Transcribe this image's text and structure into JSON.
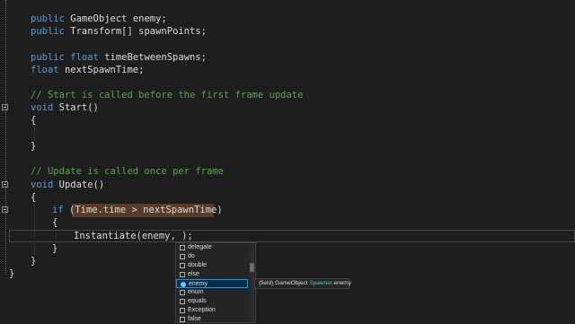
{
  "code": {
    "l1": {
      "kw": "public",
      "ty": "GameObject",
      "rest": "enemy;"
    },
    "l2": {
      "kw": "public",
      "ty": "Transform[]",
      "rest": "spawnPoints;"
    },
    "l3": {
      "kw": "public",
      "ty": "float",
      "rest": "timeBetweenSpawns;"
    },
    "l4": {
      "ty": "float",
      "rest": "nextSpawnTime;"
    },
    "l5": {
      "cm": "// Start is called before the first frame update"
    },
    "l6": {
      "kw": "void",
      "rest": "Start()"
    },
    "l7": {
      "text": "{"
    },
    "l8": {
      "text": "}"
    },
    "l9": {
      "cm": "// Update is called once per frame"
    },
    "l10": {
      "kw": "void",
      "rest": "Update()"
    },
    "l11": {
      "text": "{"
    },
    "l12": {
      "kw": "if",
      "open": "(",
      "hl": "Time.time > nextSpawnTime",
      "close": ")"
    },
    "l13": {
      "text": "{"
    },
    "l14": {
      "text": "Instantiate(enemy, );"
    },
    "l15": {
      "text": "}"
    },
    "l16": {
      "text": "}"
    },
    "l17": {
      "text": "}"
    }
  },
  "completion": {
    "items": [
      "delegate",
      "do",
      "double",
      "else",
      "enemy",
      "enum",
      "equals",
      "Exception",
      "false"
    ],
    "selected_index": 4
  },
  "tooltip": {
    "prefix": "(field) GameObject ",
    "type": "Spawner",
    "suffix": ".enemy"
  },
  "colors": {
    "keyword": "#569cd6",
    "type": "#4ec9b0",
    "comment": "#57a64a",
    "background": "#1e1e1e",
    "highlight": "#5a3a28"
  }
}
